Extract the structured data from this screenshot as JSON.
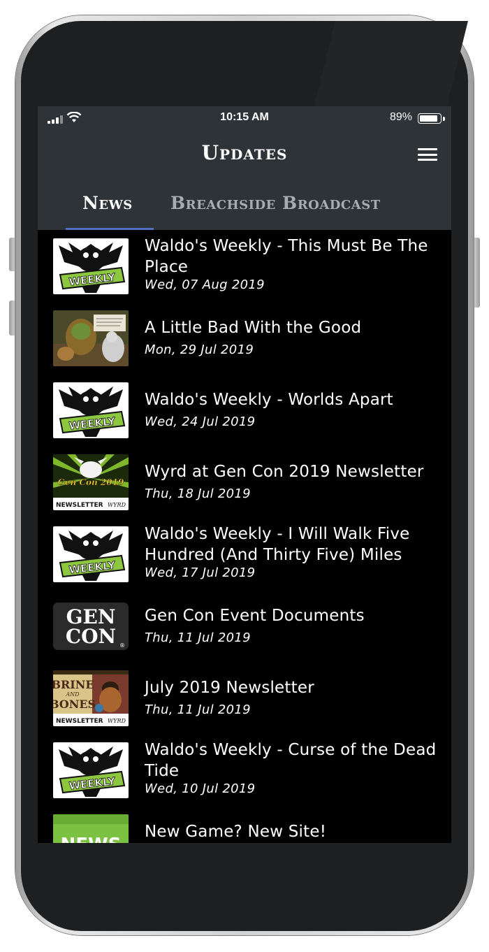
{
  "status_bar": {
    "time": "10:15 AM",
    "battery_percent": "89%",
    "battery_level": 0.89
  },
  "header": {
    "title": "Updates",
    "menu_icon": "hamburger-menu-icon"
  },
  "tabs": [
    {
      "label": "News",
      "selected": true
    },
    {
      "label": "Breachside Broadcast",
      "selected": false
    }
  ],
  "colors": {
    "header_bg": "#2e3338",
    "tab_indicator": "#4f6fc2",
    "list_bg": "#000000",
    "weekly_green": "#8dc63f"
  },
  "news": [
    {
      "title": "Waldo's Weekly - This Must Be The Place",
      "date": "Wed, 07 Aug 2019",
      "thumb": "weekly",
      "thumb_text": "WEEKLY"
    },
    {
      "title": "A Little Bad With the Good",
      "date": "Mon, 29 Jul 2019",
      "thumb": "artwork"
    },
    {
      "title": "Waldo's Weekly - Worlds Apart",
      "date": "Wed, 24 Jul 2019",
      "thumb": "weekly",
      "thumb_text": "WEEKLY"
    },
    {
      "title": "Wyrd at Gen Con 2019 Newsletter",
      "date": "Thu, 18 Jul 2019",
      "thumb": "gencon-newsletter",
      "thumb_text": "Gen Con 2019",
      "thumb_footer": "NEWSLETTER",
      "thumb_footer_right": "WYRD"
    },
    {
      "title": "Waldo's Weekly - I Will Walk Five Hundred (And Thirty Five) Miles",
      "date": "Wed, 17 Jul 2019",
      "thumb": "weekly",
      "thumb_text": "WEEKLY"
    },
    {
      "title": "Gen Con Event Documents",
      "date": "Thu, 11 Jul 2019",
      "thumb": "gencon-logo",
      "thumb_text": "GEN",
      "thumb_text2": "CON",
      "thumb_mark": "®"
    },
    {
      "title": "July 2019 Newsletter",
      "date": "Thu, 11 Jul 2019",
      "thumb": "brine-newsletter",
      "thumb_text": "BRINE",
      "thumb_text_mid": "AND",
      "thumb_text2": "BONES",
      "thumb_footer": "NEWSLETTER",
      "thumb_footer_right": "WYRD"
    },
    {
      "title": "Waldo's Weekly - Curse of the Dead Tide",
      "date": "Wed, 10 Jul 2019",
      "thumb": "weekly",
      "thumb_text": "WEEKLY"
    },
    {
      "title": "New Game? New Site!",
      "date": "",
      "thumb": "news-green",
      "thumb_text": "NEWS"
    }
  ]
}
